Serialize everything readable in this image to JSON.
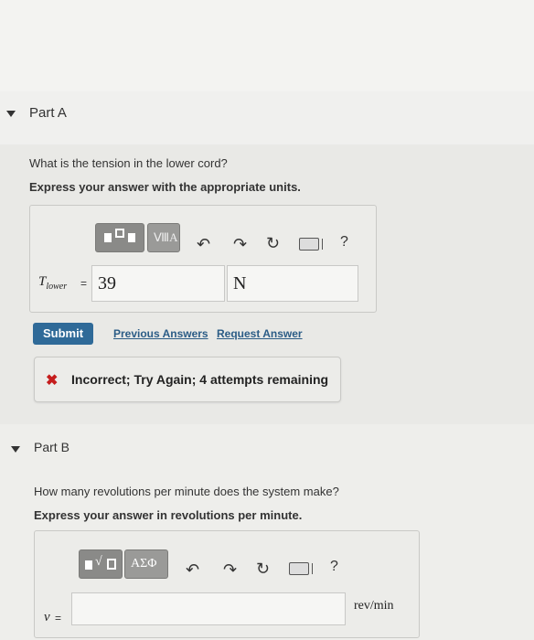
{
  "part_a": {
    "title": "Part A",
    "question": "What is the tension in the lower cord?",
    "instruction": "Express your answer with the appropriate units.",
    "variable": "T",
    "variable_sub": "lower",
    "equals": "=",
    "value": "39",
    "units": "N",
    "toolbar": {
      "template_btn": "■⬚■",
      "format_btn": "ⅧA",
      "help": "?"
    },
    "submit_label": "Submit",
    "previous_answers_label": "Previous Answers",
    "request_answer_label": "Request Answer",
    "feedback": "Incorrect; Try Again; 4 attempts remaining"
  },
  "part_b": {
    "title": "Part B",
    "question": "How many revolutions per minute does the system make?",
    "instruction": "Express your answer in revolutions per minute.",
    "variable": "ν",
    "equals": "=",
    "units": "rev/min",
    "toolbar": {
      "template_btn": "░√□",
      "symbols_btn": "ΑΣΦ",
      "help": "?"
    }
  },
  "colors": {
    "submit": "#2f6a98",
    "link": "#2b5c86",
    "error": "#c51d1d"
  }
}
